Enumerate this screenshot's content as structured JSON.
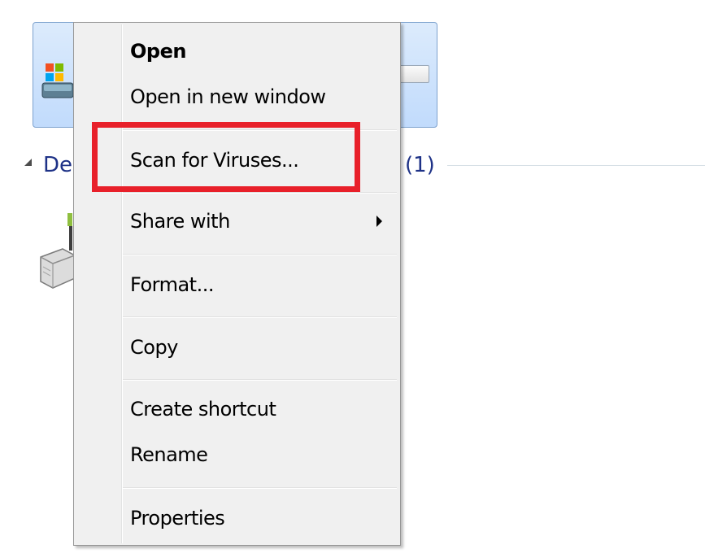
{
  "group": {
    "title_visible": "De",
    "count": "(1)"
  },
  "context_menu": {
    "items": {
      "open": "Open",
      "open_new_window": "Open in new window",
      "scan": "Scan for Viruses...",
      "share_with": "Share with",
      "format": "Format...",
      "copy": "Copy",
      "create_shortcut": "Create shortcut",
      "rename": "Rename",
      "properties": "Properties"
    }
  },
  "icons": {
    "drive": "windows-drive-icon",
    "device": "removable-drive-icon",
    "submenu": "chevron-right-icon",
    "collapse": "collapse-arrow-icon"
  },
  "colors": {
    "highlight": "#e8202a",
    "group_text": "#1e3287",
    "menu_bg": "#f0f0f0",
    "selection_bg": "#c1dbfc"
  }
}
